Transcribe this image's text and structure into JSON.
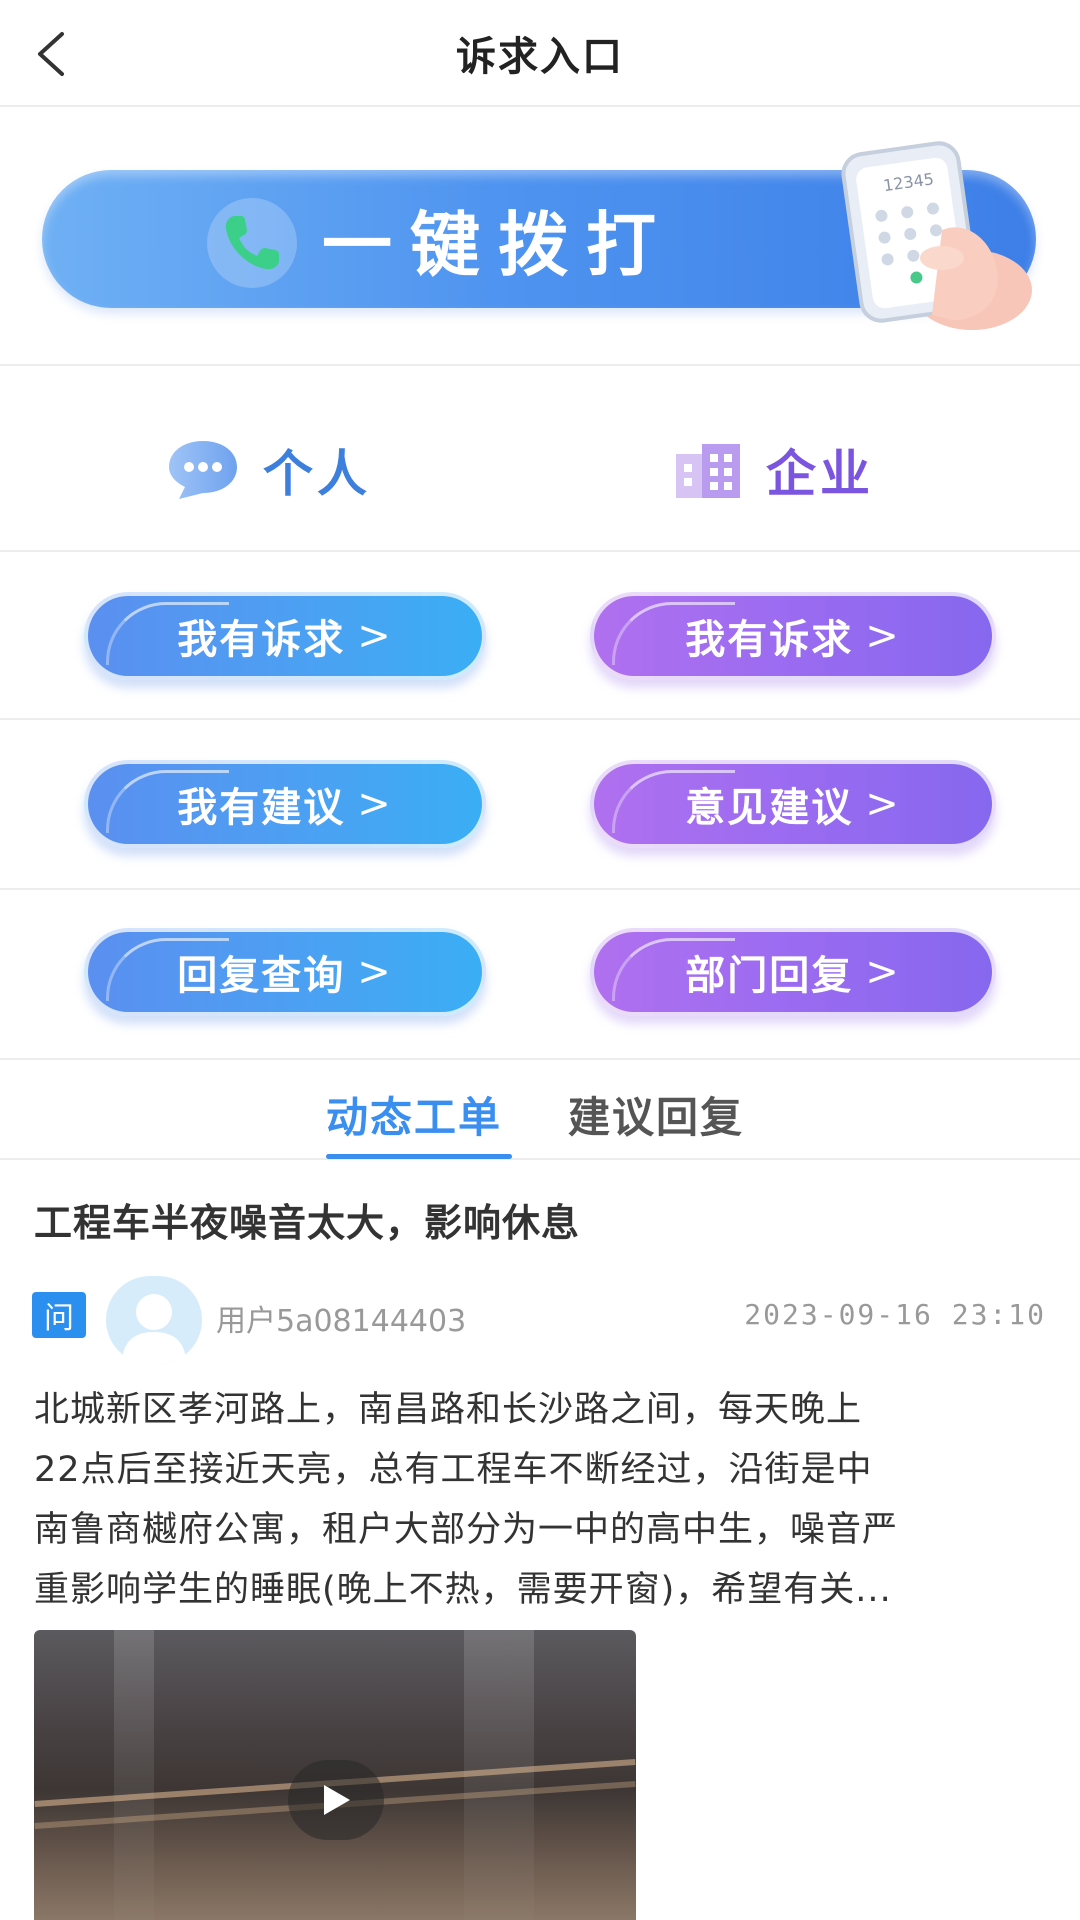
{
  "header": {
    "title": "诉求入口"
  },
  "call_banner": {
    "label": "一键拨打",
    "phone_number": "12345"
  },
  "categories": {
    "personal": "个人",
    "company": "企业"
  },
  "personal_buttons": [
    {
      "label": "我有诉求"
    },
    {
      "label": "我有建议"
    },
    {
      "label": "回复查询"
    }
  ],
  "company_buttons": [
    {
      "label": "我有诉求"
    },
    {
      "label": "意见建议"
    },
    {
      "label": "部门回复"
    }
  ],
  "arrow": ">",
  "tabs": [
    {
      "label": "动态工单",
      "active": true
    },
    {
      "label": "建议回复",
      "active": false
    }
  ],
  "post": {
    "title": "工程车半夜噪音太大，影响休息",
    "badge": "问",
    "username": "用户5a08144403",
    "time": "2023-09-16 23:10",
    "body_lines": [
      "北城新区孝河路上，南昌路和长沙路之间，每天晚上",
      "22点后至接近天亮，总有工程车不断经过，沿街是中",
      "南鲁商樾府公寓，租户大部分为一中的高中生，噪音严",
      "重影响学生的睡眠(晚上不热，需要开窗)，希望有关..."
    ]
  },
  "colors": {
    "accent_blue": "#3a8ef0",
    "accent_purple": "#7b55e0"
  }
}
